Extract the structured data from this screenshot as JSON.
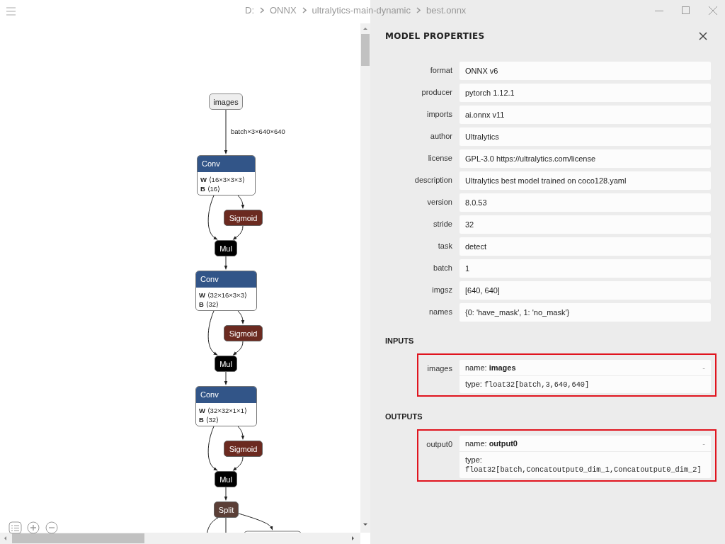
{
  "breadcrumb": [
    "D:",
    "ONNX",
    "ultralytics-main-dynamic",
    "best.onnx"
  ],
  "graph": {
    "edge_label": "batch×3×640×640",
    "nodes": [
      {
        "kind": "input",
        "title": "images"
      },
      {
        "kind": "conv",
        "title": "Conv",
        "attributes": [
          {
            "name": "W",
            "value": "⟨16×3×3×3⟩"
          },
          {
            "name": "B",
            "value": "⟨16⟩"
          }
        ]
      },
      {
        "kind": "activation",
        "title": "Sigmoid"
      },
      {
        "kind": "mul",
        "title": "Mul"
      },
      {
        "kind": "conv",
        "title": "Conv",
        "attributes": [
          {
            "name": "W",
            "value": "⟨32×16×3×3⟩"
          },
          {
            "name": "B",
            "value": "⟨32⟩"
          }
        ]
      },
      {
        "kind": "activation",
        "title": "Sigmoid"
      },
      {
        "kind": "mul",
        "title": "Mul"
      },
      {
        "kind": "conv",
        "title": "Conv",
        "attributes": [
          {
            "name": "W",
            "value": "⟨32×32×1×1⟩"
          },
          {
            "name": "B",
            "value": "⟨32⟩"
          }
        ]
      },
      {
        "kind": "activation",
        "title": "Sigmoid"
      },
      {
        "kind": "mul",
        "title": "Mul"
      },
      {
        "kind": "split",
        "title": "Split"
      }
    ]
  },
  "panel": {
    "title": "MODEL PROPERTIES",
    "properties": [
      {
        "label": "format",
        "value": "ONNX v6"
      },
      {
        "label": "producer",
        "value": "pytorch 1.12.1"
      },
      {
        "label": "imports",
        "value": "ai.onnx v11"
      },
      {
        "label": "author",
        "value": "Ultralytics"
      },
      {
        "label": "license",
        "value": "GPL-3.0 https://ultralytics.com/license"
      },
      {
        "label": "description",
        "value": "Ultralytics best model trained on coco128.yaml"
      },
      {
        "label": "version",
        "value": "8.0.53"
      },
      {
        "label": "stride",
        "value": "32"
      },
      {
        "label": "task",
        "value": "detect"
      },
      {
        "label": "batch",
        "value": "1"
      },
      {
        "label": "imgsz",
        "value": "[640, 640]"
      },
      {
        "label": "names",
        "value": "{0: 'have_mask', 1: 'no_mask'}"
      }
    ],
    "sections": [
      {
        "title": "INPUTS",
        "items": [
          {
            "label": "images",
            "name_label": "name:",
            "name": "images",
            "type_label": "type:",
            "type": "float32[batch,3,640,640]",
            "toggle": "-",
            "highlighted": true
          }
        ]
      },
      {
        "title": "OUTPUTS",
        "items": [
          {
            "label": "output0",
            "name_label": "name:",
            "name": "output0",
            "type_label": "type:",
            "type": "float32[batch,Concatoutput0_dim_1,Concatoutput0_dim_2]",
            "toggle": "-",
            "highlighted": true
          }
        ]
      }
    ]
  }
}
